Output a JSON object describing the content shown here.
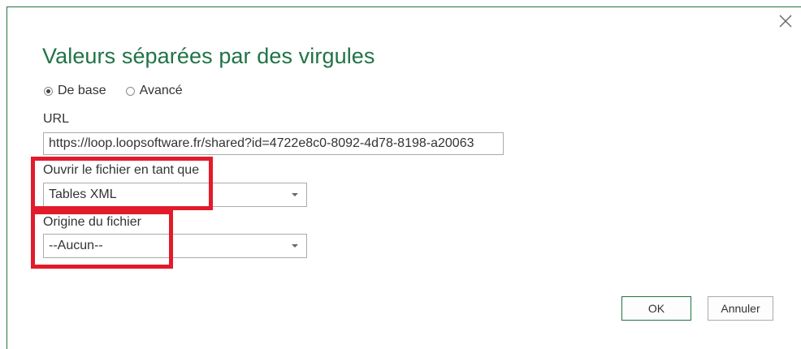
{
  "dialog": {
    "title": "Valeurs séparées par des virgules",
    "close_icon": "close-icon"
  },
  "mode": {
    "options": [
      {
        "label": "De base",
        "checked": true
      },
      {
        "label": "Avancé",
        "checked": false
      }
    ]
  },
  "url": {
    "label": "URL",
    "value": "https://loop.loopsoftware.fr/shared?id=4722e8c0-8092-4d78-8198-a20063"
  },
  "open_as": {
    "label": "Ouvrir le fichier en tant que",
    "value": "Tables XML"
  },
  "file_origin": {
    "label": "Origine du fichier",
    "value": "--Aucun--"
  },
  "buttons": {
    "ok": "OK",
    "cancel": "Annuler"
  },
  "colors": {
    "accent": "#217346",
    "highlight": "#e21b2b"
  }
}
